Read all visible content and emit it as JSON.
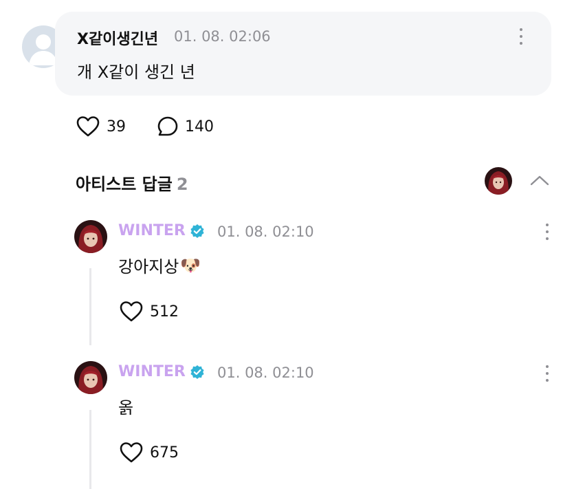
{
  "comment": {
    "author": "X같이생긴년",
    "time": "01. 08. 02:06",
    "text": "개 X같이 생긴 년",
    "likes": "39",
    "replies": "140"
  },
  "artist_replies": {
    "title": "아티스트 답글",
    "count": "2",
    "items": [
      {
        "author": "WINTER",
        "time": "01. 08. 02:10",
        "text": "강아지상",
        "emoji": "🐶",
        "likes": "512"
      },
      {
        "author": "WINTER",
        "time": "01. 08. 02:10",
        "text": "옭",
        "emoji": "",
        "likes": "675"
      }
    ]
  },
  "colors": {
    "bubble": "#f5f6f8",
    "artist_name": "#c9a3ef",
    "verified": "#2fb3d6",
    "muted": "#8f8f94"
  },
  "icons": {
    "like": "heart-outline-icon",
    "reply": "speech-bubble-icon",
    "more": "kebab-menu-icon",
    "collapse": "chevron-up-icon",
    "verified": "verified-badge-icon"
  }
}
